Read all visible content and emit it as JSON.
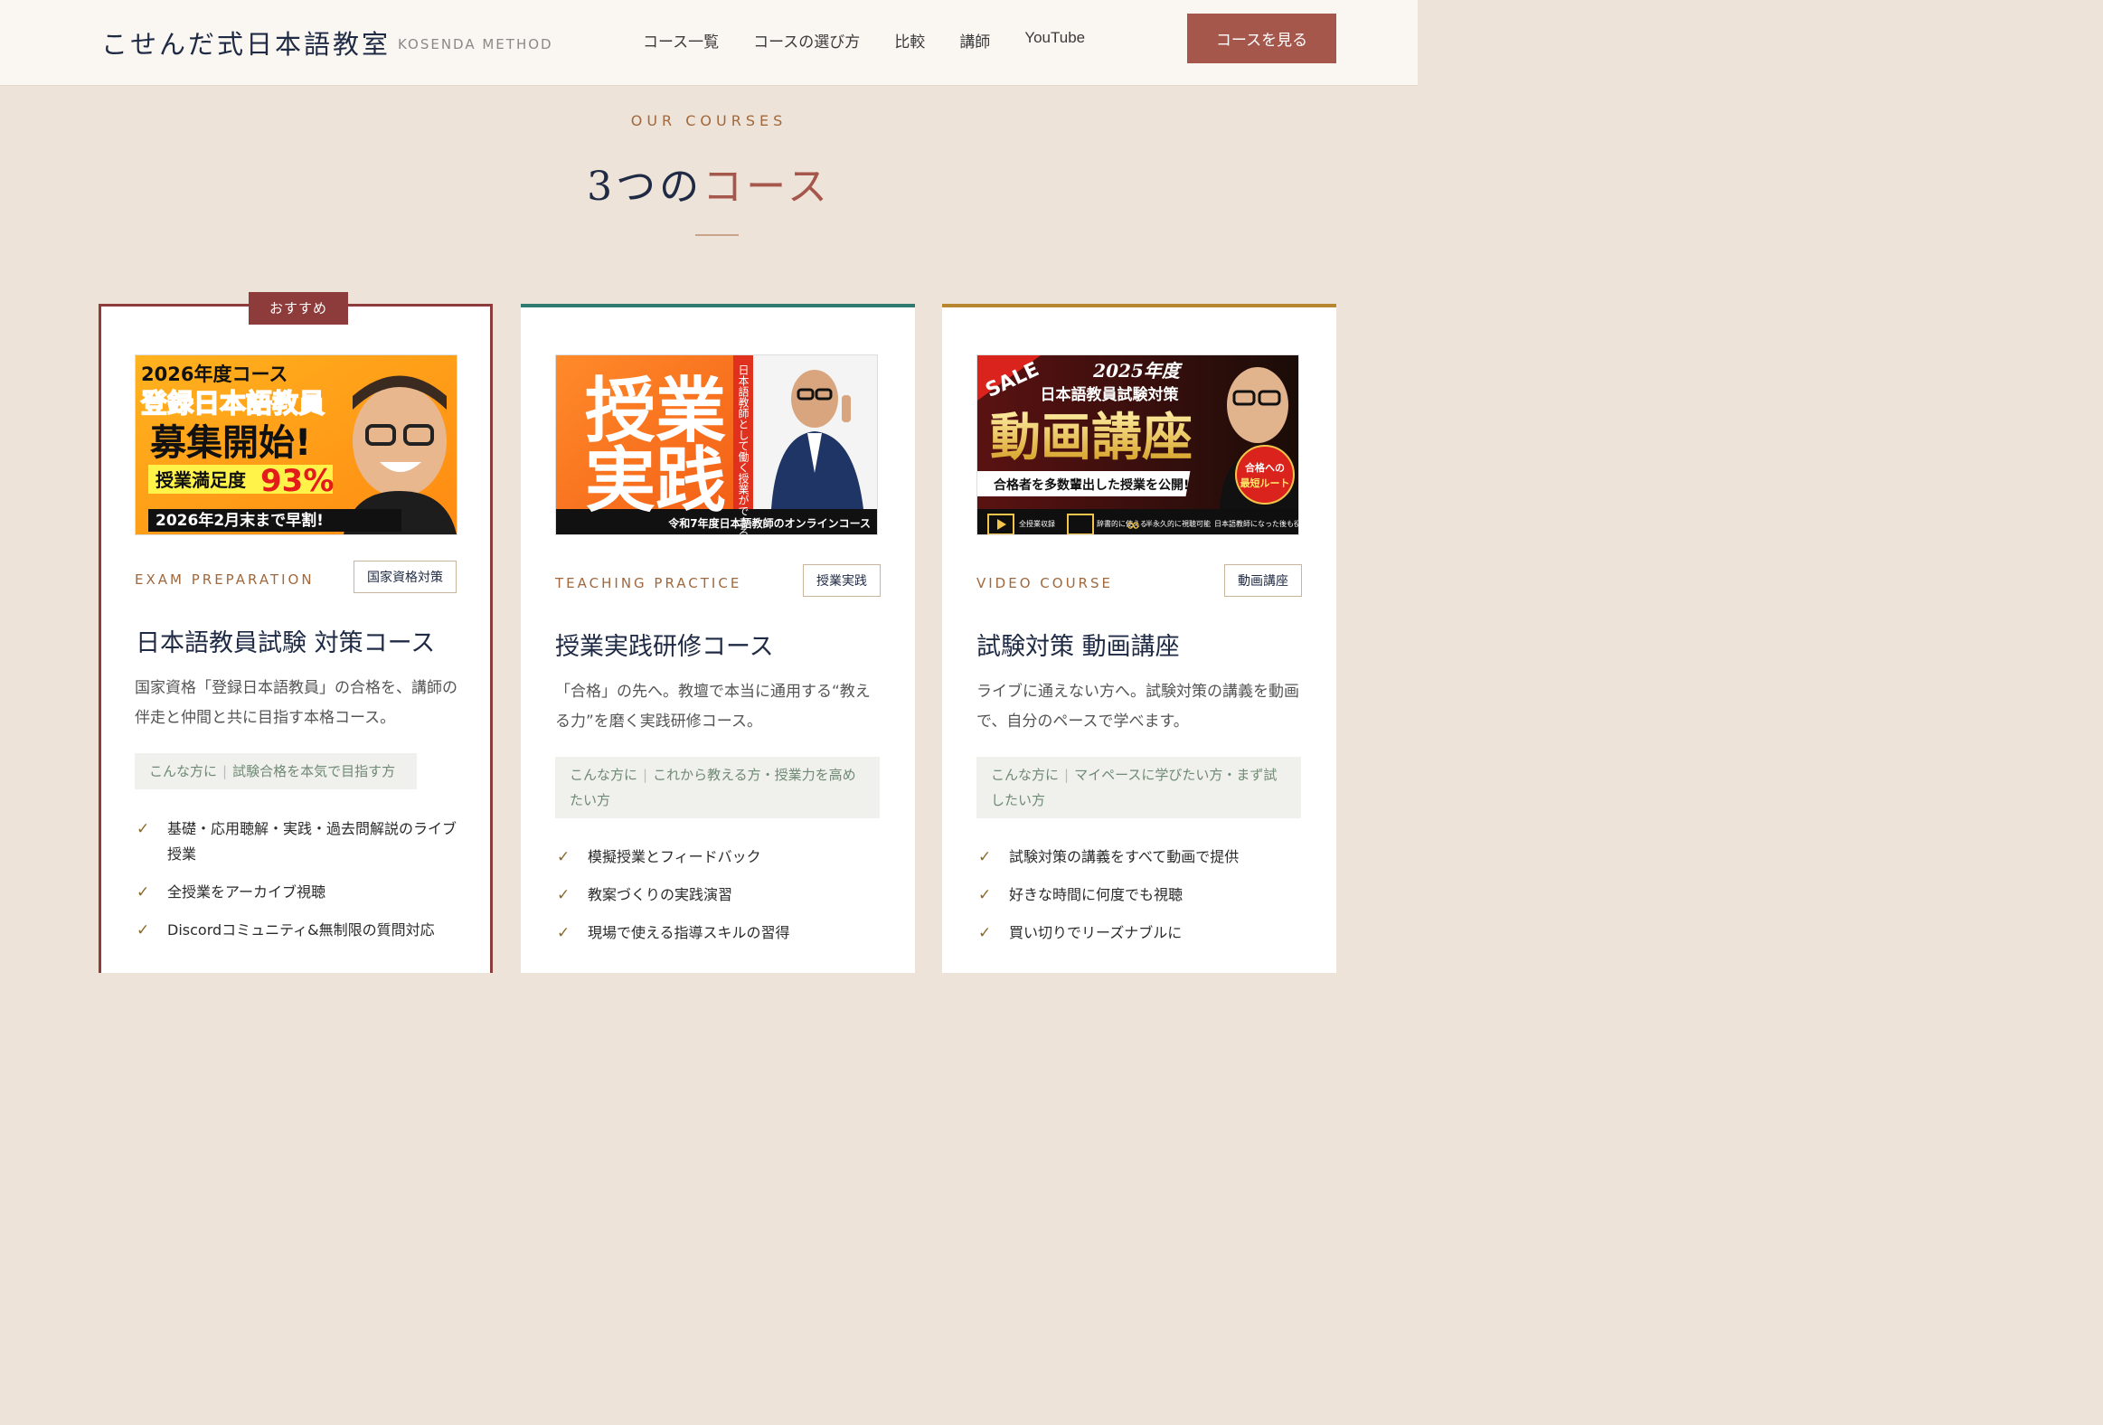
{
  "header": {
    "logo": "こせんだ式日本語教室",
    "logo_sub": "KOSENDA METHOD",
    "nav": [
      "コース一覧",
      "コースの選び方",
      "比較",
      "講師",
      "YouTube"
    ],
    "cta": "コースを見る"
  },
  "section": {
    "eyebrow": "OUR COURSES",
    "title_a": "3つの",
    "title_b": "コース"
  },
  "cards": [
    {
      "badge": "おすすめ",
      "thumb": {
        "l1": "2026年度コース",
        "l2": "登録日本語教員",
        "l3": "募集開始!",
        "l4": "授業満足度",
        "l4b": "93%",
        "l5": "2026年2月末まで早割!"
      },
      "en": "EXAM PREPARATION",
      "tag": "国家資格対策",
      "title": "日本語教員試験 対策コース",
      "desc": "国家資格「登録日本語教員」の合格を、講師の伴走と仲間と共に目指す本格コース。",
      "who_label": "こんな方に",
      "who_text": "試験合格を本気で目指す方",
      "features": [
        "基礎・応用聴解・実践・過去問解説のライブ授業",
        "全授業をアーカイブ視聴",
        "Discordコミュニティ&無制限の質問対応"
      ]
    },
    {
      "thumb": {
        "big": "授業実践",
        "side": "日本語教師として働く授業ができるように!",
        "bottom": "令和7年度日本語教師のオンラインコース"
      },
      "en": "TEACHING PRACTICE",
      "tag": "授業実践",
      "title": "授業実践研修コース",
      "desc": "「合格」の先へ。教壇で本当に通用する“教える力”を磨く実践研修コース。",
      "who_label": "こんな方に",
      "who_text": "これから教える方・授業力を高めたい方",
      "features": [
        "模擬授業とフィードバック",
        "教案づくりの実践演習",
        "現場で使える指導スキルの習得"
      ]
    },
    {
      "thumb": {
        "sale": "SALE",
        "year": "2025年度",
        "sub": "日本語教員試験対策",
        "big": "動画講座",
        "strip": "合格者を多数輩出した授業を公開!",
        "circle": "合格への最短ルート",
        "icons": [
          "全授業収録",
          "辞書的に使える",
          "半永久的に視聴可能",
          "日本語教師になった後も役立つ"
        ]
      },
      "en": "VIDEO COURSE",
      "tag": "動画講座",
      "title": "試験対策 動画講座",
      "desc": "ライブに通えない方へ。試験対策の講義を動画で、自分のペースで学べます。",
      "who_label": "こんな方に",
      "who_text": "マイペースに学びたい方・まず試したい方",
      "features": [
        "試験対策の講義をすべて動画で提供",
        "好きな時間に何度でも視聴",
        "買い切りでリーズナブルに"
      ]
    }
  ],
  "colors": {
    "accent": "#a5574b",
    "navy": "#1f2a44",
    "teal": "#2f7a6f",
    "gold": "#b8862e",
    "bg": "#ede3d8"
  }
}
